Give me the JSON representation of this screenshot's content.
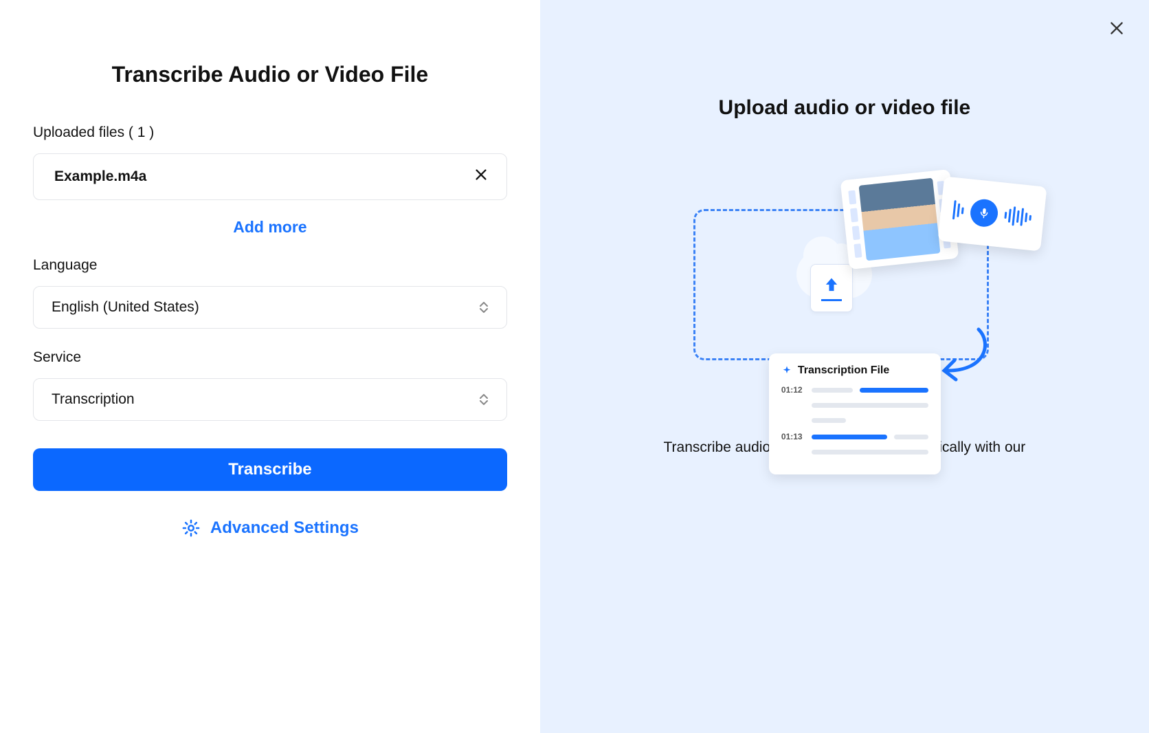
{
  "left": {
    "title": "Transcribe Audio or Video File",
    "uploaded_label": "Uploaded files ( 1 )",
    "file_name": "Example.m4a",
    "add_more": "Add more",
    "language_label": "Language",
    "language_value": "English (United States)",
    "service_label": "Service",
    "service_value": "Transcription",
    "transcribe_btn": "Transcribe",
    "advanced": "Advanced Settings"
  },
  "right": {
    "heading": "Upload audio or video file",
    "description": "Transcribe audio to text easily and automatically with our advanced tools.",
    "illus": {
      "trans_card_title": "Transcription File",
      "ts1": "01:12",
      "ts2": "01:13"
    }
  }
}
